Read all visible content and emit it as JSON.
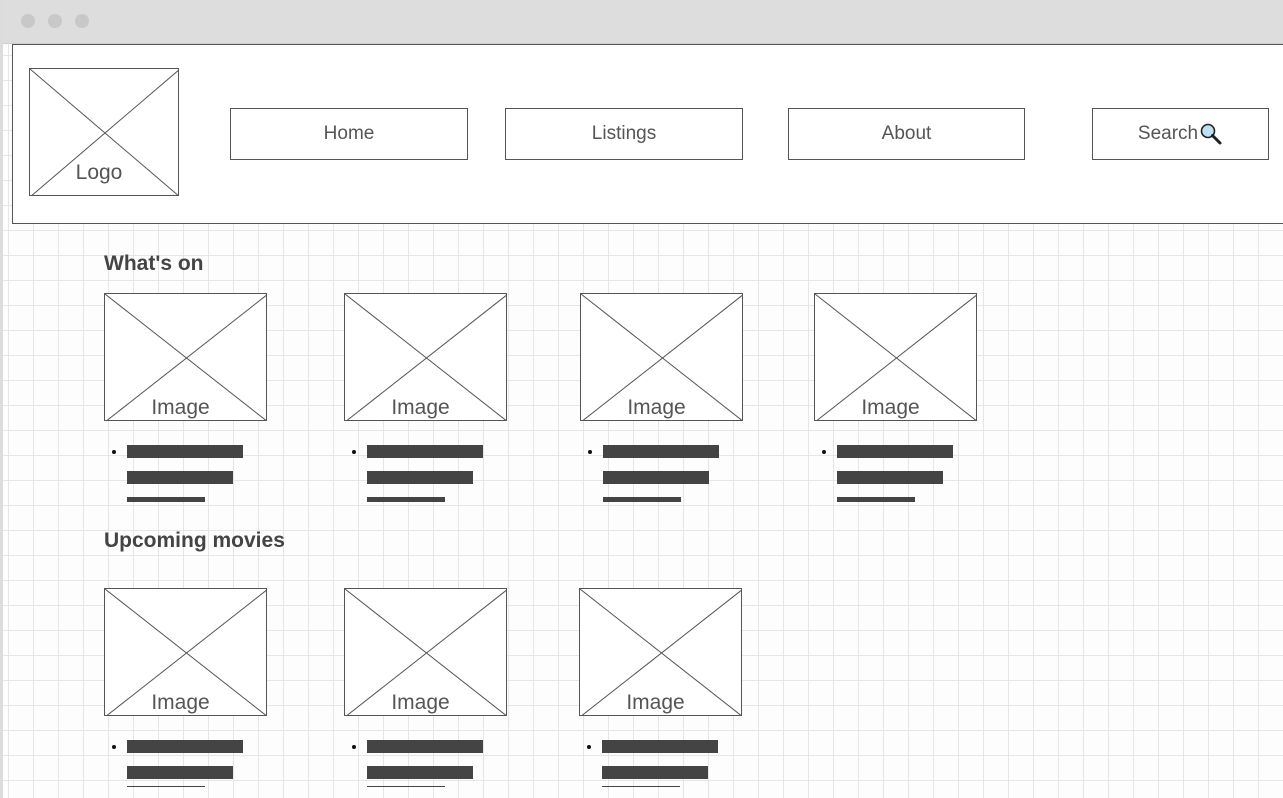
{
  "header": {
    "logo_label": "Logo",
    "nav": [
      {
        "label": "Home"
      },
      {
        "label": "Listings"
      },
      {
        "label": "About"
      }
    ],
    "search_label": "Search"
  },
  "sections": [
    {
      "title": "What's on",
      "image_label": "Image"
    },
    {
      "title": "Upcoming movies",
      "image_label": "Image"
    }
  ],
  "icons": {
    "search": "magnifier-icon"
  },
  "colors": {
    "stroke": "#555555",
    "text_bar": "#444444",
    "grid": "#e6e6e6"
  }
}
